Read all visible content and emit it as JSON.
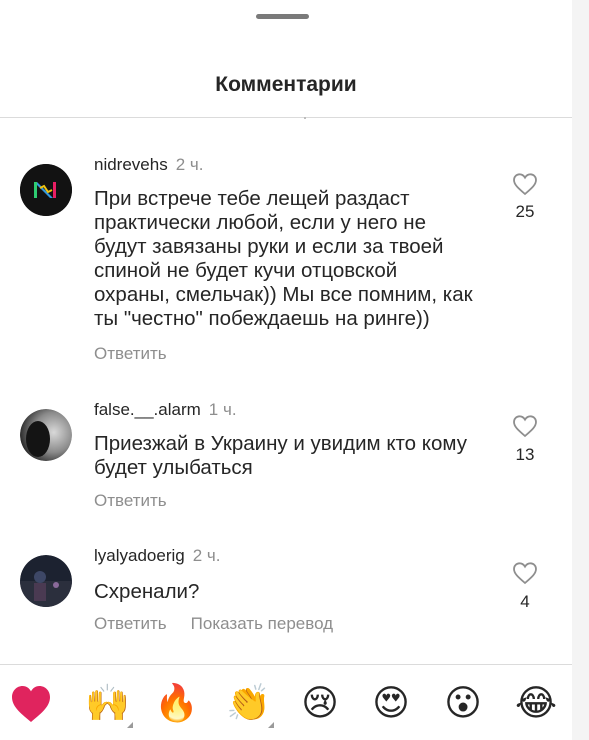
{
  "header": {
    "title": "Комментарии"
  },
  "comments": [
    {
      "username": "nidrevehs",
      "time": "2 ч.",
      "lines": [
        "При встрече тебе лещей раздаст",
        "практически любой, если у него не",
        "будут завязаны руки и если за твоей",
        "спиной не будет кучи отцовской",
        "охраны, смельчак)) Мы все помним, как",
        "ты \"честно\" побеждаешь на ринге))"
      ],
      "reply_label": "Ответить",
      "likes": "25"
    },
    {
      "username": "false.__.alarm",
      "time": "1 ч.",
      "lines": [
        "Приезжай в Украину и увидим кто кому",
        "будет улыбаться"
      ],
      "reply_label": "Ответить",
      "likes": "13"
    },
    {
      "username": "lyalyadoerig",
      "time": "2 ч.",
      "lines": [
        "Схренали?"
      ],
      "reply_label": "Ответить",
      "translate_label": "Показать перевод",
      "likes": "4"
    }
  ],
  "reactions": [
    {
      "name": "red-heart",
      "glyph": "❤️"
    },
    {
      "name": "raising-hands",
      "glyph": "🙌"
    },
    {
      "name": "fire",
      "glyph": "🔥"
    },
    {
      "name": "clapping-hands",
      "glyph": "👏"
    },
    {
      "name": "crying-face",
      "glyph": "😢"
    },
    {
      "name": "heart-eyes",
      "glyph": "😍"
    },
    {
      "name": "surprised-face",
      "glyph": "😮"
    },
    {
      "name": "tears-of-joy",
      "glyph": "😂"
    }
  ],
  "colors": {
    "text": "#262626",
    "secondary": "#8e8e8e",
    "divider": "#dbdbdb",
    "heart": "#e0245e"
  }
}
